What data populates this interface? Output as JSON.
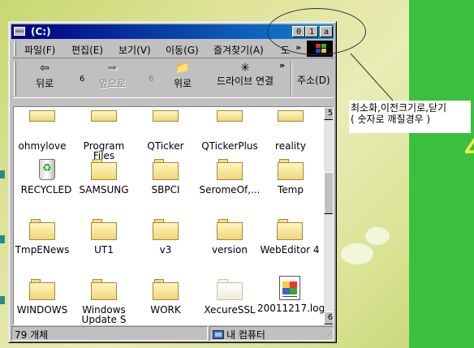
{
  "window": {
    "title": "(C:)",
    "title_buttons": [
      "0",
      "1",
      "a"
    ]
  },
  "menubar": {
    "items": [
      "파일(F)",
      "편집(E)",
      "보기(V)",
      "이동(G)",
      "즐겨찾기(A)",
      "도"
    ],
    "more": "»"
  },
  "toolbar": {
    "back": {
      "label": "뒤로",
      "icon": "back-arrow-icon"
    },
    "back_drop": "6",
    "forward": {
      "label": "앞으로",
      "icon": "forward-arrow-icon"
    },
    "forward_drop": "6",
    "up": {
      "label": "위로",
      "icon": "up-folder-icon"
    },
    "drive": {
      "label": "드라이브 연결",
      "icon": "map-drive-icon"
    },
    "more": "»",
    "address_label": "주소(D)"
  },
  "files": [
    {
      "name": "ohmylove",
      "type": "folder"
    },
    {
      "name": "Program Files",
      "type": "folder"
    },
    {
      "name": "QTicker",
      "type": "folder"
    },
    {
      "name": "QTickerPlus",
      "type": "folder"
    },
    {
      "name": "reality",
      "type": "folder"
    },
    {
      "name": "RECYCLED",
      "type": "recycle"
    },
    {
      "name": "SAMSUNG",
      "type": "folder"
    },
    {
      "name": "SBPCI",
      "type": "folder"
    },
    {
      "name": "SeromeOf,...",
      "type": "folder"
    },
    {
      "name": "Temp",
      "type": "folder"
    },
    {
      "name": "TmpENews",
      "type": "folder"
    },
    {
      "name": "UT1",
      "type": "folder"
    },
    {
      "name": "v3",
      "type": "folder"
    },
    {
      "name": "version",
      "type": "folder"
    },
    {
      "name": "WebEditor 4",
      "type": "folder"
    },
    {
      "name": "WINDOWS",
      "type": "folder"
    },
    {
      "name": "Windows Update S",
      "type": "folder"
    },
    {
      "name": "WORK",
      "type": "folder"
    },
    {
      "name": "XecureSSL",
      "type": "folder"
    },
    {
      "name": "20011217.log",
      "type": "document"
    }
  ],
  "scrollbar": {
    "up": "5",
    "down": "6"
  },
  "statusbar": {
    "count": "79 개체",
    "location": "내 컴퓨터"
  },
  "annotation": {
    "line1": "최소화,이전크기로,닫기",
    "line2": "( 숫자로 깨질경우 )"
  },
  "desktop": {
    "side_text": "4"
  }
}
